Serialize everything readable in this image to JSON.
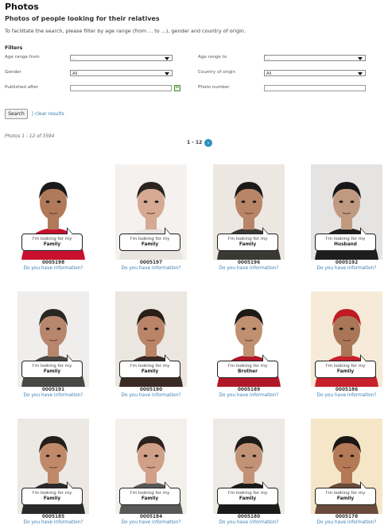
{
  "page": {
    "title": "Photos",
    "subtitle": "Photos of people looking for their relatives",
    "intro": "To facilitate the search, please filter by age range (from ... to ...), gender and country of origin."
  },
  "filters": {
    "title": "Filters",
    "age_from_label": "Age range from",
    "age_from_value": "...",
    "age_to_label": "Age range to",
    "age_to_value": "...",
    "gender_label": "Gender",
    "gender_value": "All",
    "country_label": "Country of origin",
    "country_value": "All",
    "published_label": "Published after",
    "published_value": "",
    "photo_number_label": "Photo number",
    "photo_number_value": "",
    "search_label": "Search",
    "clear_label": "| clear results"
  },
  "results": {
    "count_text": "Photos 1 - 12 of 3594",
    "pager_text": "1 - 12",
    "next_icon": "chevron-right-icon"
  },
  "photos": [
    {
      "number": "0005198",
      "looking_label": "I'm looking for my",
      "relation": "Family",
      "info": "Do you have information?",
      "bg": "#ffffff",
      "skin": "#b07a5a",
      "hair": "#1a1a1a",
      "cloth": "#c8102e"
    },
    {
      "number": "0005197",
      "looking_label": "I'm looking for my",
      "relation": "Family",
      "info": "Do you have information?",
      "bg": "#f4f1ee",
      "skin": "#d6a993",
      "hair": "#2a2520",
      "cloth": "#e8e4e0"
    },
    {
      "number": "0005196",
      "looking_label": "I'm looking for my",
      "relation": "Family",
      "info": "Do you have information?",
      "bg": "#ece7e1",
      "skin": "#b98568",
      "hair": "#1c1a18",
      "cloth": "#3a3a34"
    },
    {
      "number": "0005192",
      "looking_label": "I'm looking for my",
      "relation": "Husband",
      "info": "Do you have information?",
      "bg": "#e6e3e3",
      "skin": "#c09a80",
      "hair": "#161616",
      "cloth": "#1e1e1e"
    },
    {
      "number": "0005191",
      "looking_label": "I'm looking for my",
      "relation": "Family",
      "info": "Do you have information?",
      "bg": "#f0eeec",
      "skin": "#b8866c",
      "hair": "#2a2622",
      "cloth": "#4a4844"
    },
    {
      "number": "0005190",
      "looking_label": "I'm looking for my",
      "relation": "Family",
      "info": "Do you have information?",
      "bg": "#ebe6e0",
      "skin": "#b98468",
      "hair": "#2a1e18",
      "cloth": "#3a2a24"
    },
    {
      "number": "0005189",
      "looking_label": "I'm looking for my",
      "relation": "Brother",
      "info": "Do you have information?",
      "bg": "#ffffff",
      "skin": "#c09070",
      "hair": "#1e1a16",
      "cloth": "#b01828"
    },
    {
      "number": "0005186",
      "looking_label": "I'm looking for my",
      "relation": "Family",
      "info": "Do you have information?",
      "bg": "#f6ead8",
      "skin": "#a97758",
      "hair": "#c01a24",
      "cloth": "#c8202c"
    },
    {
      "number": "0005185",
      "looking_label": "I'm looking for my",
      "relation": "Family",
      "info": "Do you have information?",
      "bg": "#ece8e4",
      "skin": "#c08a6a",
      "hair": "#241e18",
      "cloth": "#2a2a2a"
    },
    {
      "number": "0005184",
      "looking_label": "I'm looking for my",
      "relation": "Family",
      "info": "Do you have information?",
      "bg": "#f3f0ec",
      "skin": "#d0a088",
      "hair": "#2a221c",
      "cloth": "#585858"
    },
    {
      "number": "0005180",
      "looking_label": "I'm looking for my",
      "relation": "Family",
      "info": "Do you have information?",
      "bg": "#ede9e4",
      "skin": "#c29276",
      "hair": "#1e1a16",
      "cloth": "#1a1a1a"
    },
    {
      "number": "0005178",
      "looking_label": "I'm looking for my",
      "relation": "Family",
      "info": "Do you have information?",
      "bg": "#f6e6c8",
      "skin": "#b47a56",
      "hair": "#1a1614",
      "cloth": "#6a4a3a"
    }
  ]
}
